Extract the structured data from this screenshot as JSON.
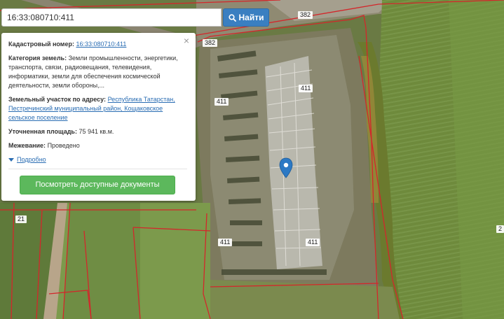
{
  "search": {
    "value": "16:33:080710:411",
    "button_label": "Найти"
  },
  "popup": {
    "close_symbol": "×",
    "cadastral_label": "Кадастровый номер:",
    "cadastral_number": "16:33:080710:411",
    "category_label": "Категория земель:",
    "category_value": "Земли промышленности, энергетики, транспорта, связи, радиовещания, телевидения, информатики, земли для обеспечения космической деятельности, земли обороны,...",
    "address_label": "Земельный участок по адресу:",
    "address_value": "Республика Татарстан, Пестречинский муниципальный район, Кощаковское сельское поселение",
    "area_label": "Уточненная площадь:",
    "area_value": "75 941 кв.м.",
    "survey_label": "Межевание:",
    "survey_value": "Проведено",
    "details_link": "Подробно",
    "docs_button": "Посмотреть доступные документы"
  },
  "map_labels": {
    "l382a": "382",
    "l382b": "382",
    "l411a": "411",
    "l411b": "411",
    "l411c": "411",
    "l411d": "411",
    "l21": "21",
    "l2": "2"
  },
  "colors": {
    "parcel_border": "#d3272b",
    "marker": "#2c79c4",
    "search_button": "#3a7fc1",
    "docs_button": "#5cb85c"
  }
}
